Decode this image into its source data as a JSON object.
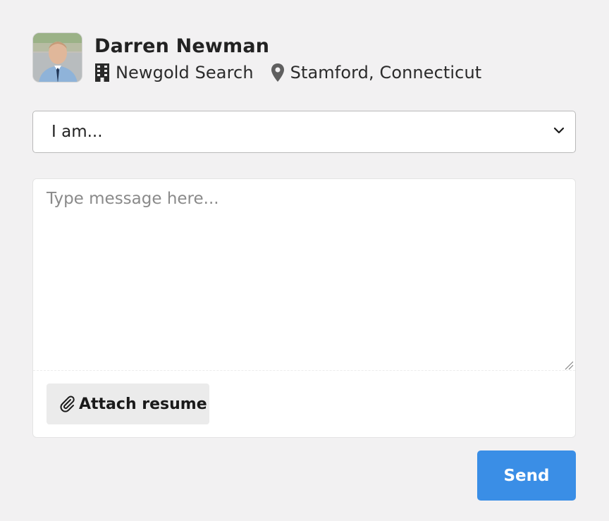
{
  "contact": {
    "name": "Darren Newman",
    "company": "Newgold Search",
    "location": "Stamford, Connecticut"
  },
  "form": {
    "role_select": {
      "selected": "I am..."
    },
    "message": {
      "placeholder": "Type message here...",
      "value": ""
    },
    "attach_label": "Attach resume",
    "send_label": "Send"
  },
  "icons": {
    "company": "building-icon",
    "location": "map-pin-icon",
    "select": "chevron-down-icon",
    "attach": "paperclip-icon"
  },
  "colors": {
    "background": "#f2f1f2",
    "accent": "#3a8ee6",
    "attach_button": "#ebebeb"
  }
}
